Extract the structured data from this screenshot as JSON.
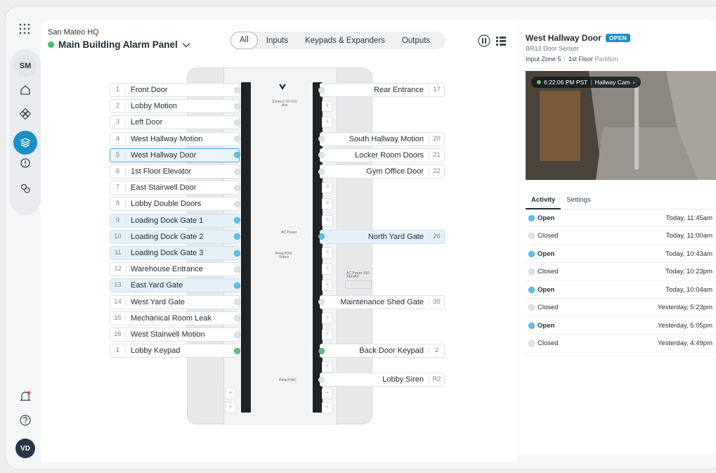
{
  "header": {
    "site": "San Mateo HQ",
    "panel_name": "Main Building Alarm Panel",
    "panel_status_color": "#3bbf6a"
  },
  "filter_tabs": [
    {
      "label": "All",
      "active": true
    },
    {
      "label": "Inputs",
      "active": false
    },
    {
      "label": "Keypads & Expanders",
      "active": false
    },
    {
      "label": "Outputs",
      "active": false
    }
  ],
  "sidebar": {
    "user_initials": "SM",
    "account_initials": "VD",
    "items": [
      "home-icon",
      "modules-icon",
      "alarm-panel-icon",
      "alert-icon",
      "integrations-icon"
    ],
    "notification_icon": "bell-icon",
    "help_icon": "help-icon"
  },
  "device": {
    "board_labels": [
      "Zones 1-32 12V Aux",
      "AC Power",
      "Relay/HAC Status",
      "AC Power 100-240VAC",
      "Relay/HAC"
    ]
  },
  "left_zones": [
    {
      "num": "1",
      "label": "Front Door",
      "state": "idle"
    },
    {
      "num": "2",
      "label": "Lobby Motion",
      "state": "idle"
    },
    {
      "num": "3",
      "label": "Left Door",
      "state": "idle"
    },
    {
      "num": "4",
      "label": "West Hallway Motion",
      "state": "idle"
    },
    {
      "num": "5",
      "label": "West Hallway Door",
      "state": "selected"
    },
    {
      "num": "6",
      "label": "1st Floor Elevator",
      "state": "idle"
    },
    {
      "num": "7",
      "label": "East Stairwell Door",
      "state": "idle"
    },
    {
      "num": "8",
      "label": "Lobby Double Doors",
      "state": "idle"
    },
    {
      "num": "9",
      "label": "Loading Dock Gate 1",
      "state": "open"
    },
    {
      "num": "10",
      "label": "Loading Dock Gate 2",
      "state": "open"
    },
    {
      "num": "11",
      "label": "Loading Dock Gate 3",
      "state": "open"
    },
    {
      "num": "12",
      "label": "Warehouse Entrance",
      "state": "idle"
    },
    {
      "num": "13",
      "label": "East Yard Gate",
      "state": "open"
    },
    {
      "num": "14",
      "label": "West Yard Gate",
      "state": "idle"
    },
    {
      "num": "15",
      "label": "Mechanical Room Leak",
      "state": "idle"
    },
    {
      "num": "16",
      "label": "West Stairwell Motion",
      "state": "idle"
    },
    {
      "num": "1",
      "label": "Lobby Keypad",
      "state": "keypad"
    }
  ],
  "right_zones": [
    {
      "num": "17",
      "label": "Rear Entrance",
      "state": "idle"
    },
    {
      "num": "20",
      "label": "South Hallway Motion",
      "state": "idle"
    },
    {
      "num": "21",
      "label": "Locker Room Doors",
      "state": "idle"
    },
    {
      "num": "22",
      "label": "Gym Office Door",
      "state": "idle"
    },
    {
      "num": "26",
      "label": "North Yard Gate",
      "state": "open"
    },
    {
      "num": "30",
      "label": "Maintenance Shed Gate",
      "state": "idle"
    },
    {
      "num": "2",
      "label": "Back Door Keypad",
      "state": "keypad"
    },
    {
      "num": "R2",
      "label": "Lobby Siren",
      "state": "idle"
    }
  ],
  "detail": {
    "title": "West Hallway Door",
    "status_badge": "OPEN",
    "badge_color": "#1d8fc2",
    "subtitle": "BR13 Door Sensor",
    "input_zone": "Input Zone 5",
    "partition_bold": "1st Floor",
    "partition_rest": "Partition",
    "camera_time": "6:22:06 PM PST",
    "camera_name": "Hallway Cam",
    "tabs": [
      {
        "label": "Activity",
        "active": true
      },
      {
        "label": "Settings",
        "active": false
      }
    ],
    "activity": [
      {
        "state": "Open",
        "time": "Today, 11:45am"
      },
      {
        "state": "Closed",
        "time": "Today, 11:00am"
      },
      {
        "state": "Open",
        "time": "Today, 10:43am"
      },
      {
        "state": "Closed",
        "time": "Today, 10:23pm"
      },
      {
        "state": "Open",
        "time": "Today, 10:04am"
      },
      {
        "state": "Closed",
        "time": "Yesterday, 5:23pm"
      },
      {
        "state": "Open",
        "time": "Yesterday, 5:05pm"
      },
      {
        "state": "Closed",
        "time": "Yesterday, 4:49pm"
      }
    ]
  }
}
